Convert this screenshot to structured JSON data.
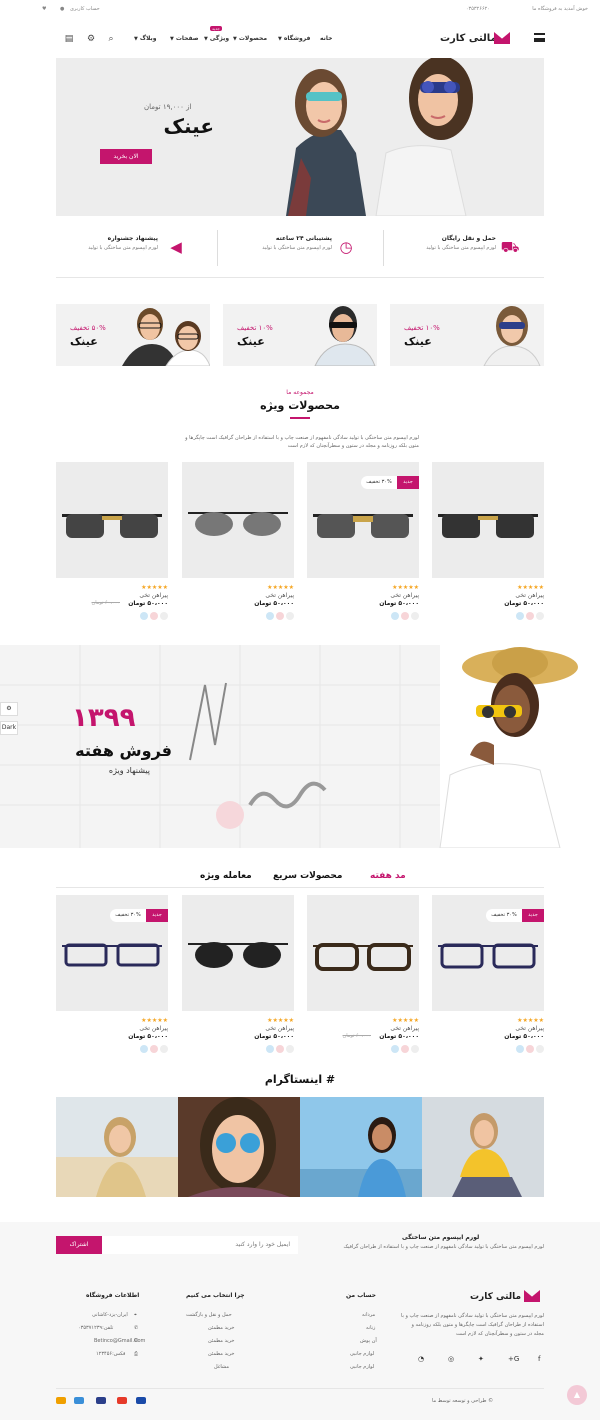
{
  "topbar": {
    "welcome": "خوش آمدید به فروشگاه ما",
    "phone": "۰۳۵۳۲۶۶۲۰",
    "account": "حساب کاربری"
  },
  "header": {
    "logo": "مالتی کارت",
    "menu": [
      {
        "label": "خانه"
      },
      {
        "label": "فروشگاه"
      },
      {
        "label": "محصولات"
      },
      {
        "label": "ویژگی"
      },
      {
        "label": "صفحات"
      },
      {
        "label": "وبلاگ"
      }
    ],
    "new_badge": "جدید"
  },
  "hero": {
    "price": "از ۱۹,۰۰۰ تومان",
    "title": "عینک",
    "button": "الان بخرید"
  },
  "features": [
    {
      "title": "حمل و نقل رایگان",
      "text": "لورم ایپسوم متن ساختگی با تولید"
    },
    {
      "title": "پشتیبانی ۲۴ ساعته",
      "text": "لورم ایپسوم متن ساختگی با تولید"
    },
    {
      "title": "پیشنهاد جشنواره",
      "text": "لورم ایپسوم متن ساختگی با تولید"
    }
  ],
  "promos": [
    {
      "discount": "۱۰% تخفیف",
      "name": "عینک"
    },
    {
      "discount": "۱۰% تخفیف",
      "name": "عینک"
    },
    {
      "discount": "۵۰% تخفیف",
      "name": "عینک"
    }
  ],
  "special": {
    "subtitle": "مجموعه ما",
    "title": "محصولات ویژه",
    "intro": "لورم ایپسوم متن ساختگی با تولید سادگی نامفهوم از صنعت چاپ و با استفاده از طراحان گرافیک است چاپگرها و متون بلکه روزنامه و مجله در ستون و سطرآنچنان که لازم است"
  },
  "products": [
    {
      "new": "جدید",
      "off": "۳۰% تخفیف",
      "stars": "★★★★★",
      "name": "پیراهن تخی",
      "price": "۵۰،۰۰۰ تومان",
      "old": "۶۰،۰۰۰ تومان"
    }
  ],
  "sale": {
    "number": "۱۳۹۹",
    "title": "فروش هفته",
    "subtitle": "پیشنهاد ویژه"
  },
  "side_tools": {
    "dark": "Dark"
  },
  "tabs": [
    "مد هفته",
    "محصولات سریع",
    "معامله ویژه"
  ],
  "instagram": {
    "title": "# اینستاگرام"
  },
  "newsletter": {
    "title": "لورم ایپسوم متن ساختگی",
    "text": "لورم ایپسوم متن ساختگی با تولید سادگی نامفهوم از صنعت چاپ و با استفاده از طراحان گرافیک",
    "placeholder": "ایمیل خود را وارد کنید",
    "button": "اشتراک"
  },
  "footer": {
    "about": "لورم ایپسوم متن ساختگی با تولید سادگی نامفهوم از صنعت چاپ و با استفاده از طراحان گرافیک است چاپگرها و متون بلکه روزنامه و مجله در ستون و سطرآنچنان که لازم است",
    "col_account": {
      "title": "حساب من",
      "items": [
        "مردانه",
        "زنانه",
        "آن پوش",
        "لوازم جانبی",
        "لوازم جانبی"
      ]
    },
    "col_why": {
      "title": "چرا انتخاب می کنیم",
      "items": [
        "حمل و نقل و بازگشت",
        "خرید مطمئن",
        "خرید مطمئن",
        "خرید مطمئن",
        "مشاغل"
      ]
    },
    "col_info": {
      "title": "اطلاعات فروشگاه",
      "items": [
        "ایران-یزد-کاشانی",
        "تلفن:۰۳۵۳۷۱۲۳۹",
        "Betinco@Gmail.Com",
        "فکس:۱۲۳۴۵۶"
      ]
    },
    "copyright": "© طراحی و توسعه توسط ما"
  }
}
